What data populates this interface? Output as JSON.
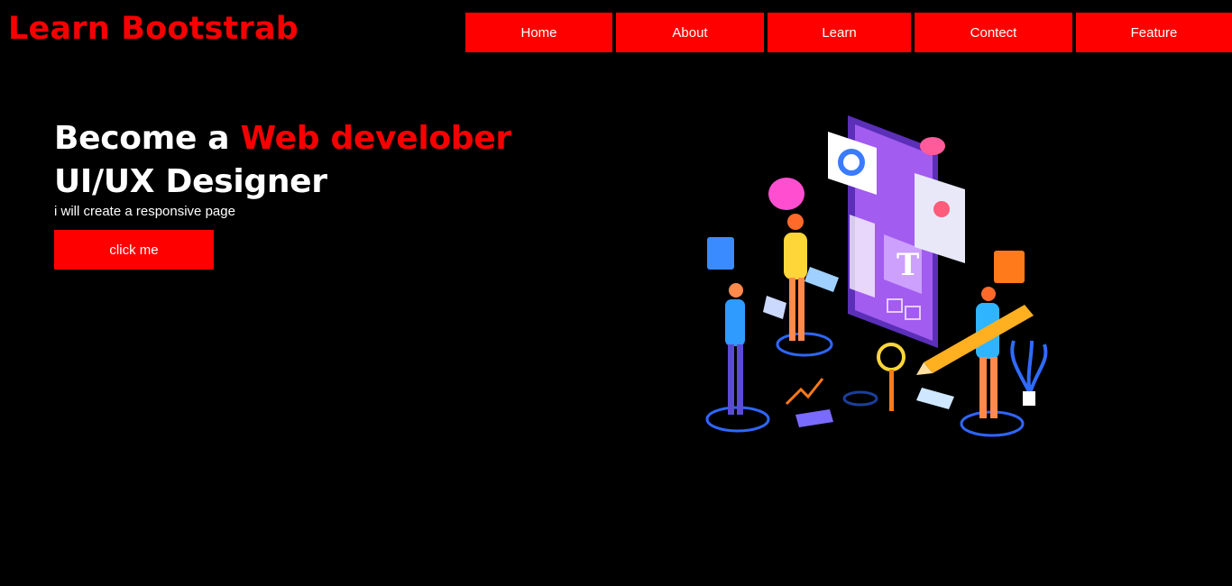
{
  "brand": {
    "name": "Learn Bootstrab"
  },
  "nav": {
    "items": [
      {
        "label": "Home"
      },
      {
        "label": "About"
      },
      {
        "label": "Learn"
      },
      {
        "label": "Contect"
      },
      {
        "label": "Feature"
      }
    ]
  },
  "hero": {
    "line1_prefix": "Become a ",
    "line1_accent": "Web develober",
    "line2": "UI/UX Designer",
    "subtitle": "i will create a responsive page",
    "button_label": "click me"
  },
  "colors": {
    "background": "#000000",
    "accent": "#ff0000",
    "text": "#ffffff"
  },
  "illustration": {
    "icon": "web-design-isometric-illustration"
  }
}
